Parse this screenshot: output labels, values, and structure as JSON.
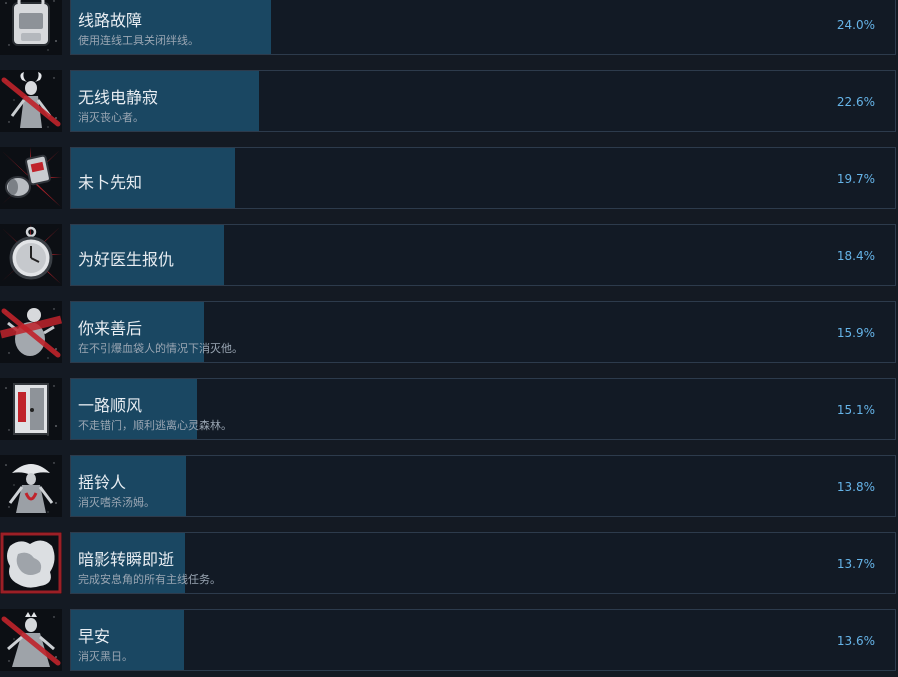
{
  "achievements": [
    {
      "title": "线路故障",
      "description": "使用连线工具关闭绊线。",
      "percent_text": "24.0%",
      "percent": 24.0,
      "icon": "backpack-icon"
    },
    {
      "title": "无线电静寂",
      "description": "消灭丧心者。",
      "percent_text": "22.6%",
      "percent": 22.6,
      "icon": "horned-creature-icon"
    },
    {
      "title": "未卜先知",
      "description": "",
      "percent_text": "19.7%",
      "percent": 19.7,
      "icon": "explosive-barrel-icon"
    },
    {
      "title": "为好医生报仇",
      "description": "",
      "percent_text": "18.4%",
      "percent": 18.4,
      "icon": "pocket-watch-icon"
    },
    {
      "title": "你来善后",
      "description": "在不引爆血袋人的情况下消灭他。",
      "percent_text": "15.9%",
      "percent": 15.9,
      "icon": "bloated-creature-icon"
    },
    {
      "title": "一路顺风",
      "description": "不走错门，顺利逃离心灵森林。",
      "percent_text": "15.1%",
      "percent": 15.1,
      "icon": "door-icon"
    },
    {
      "title": "摇铃人",
      "description": "消灭嗜杀汤姆。",
      "percent_text": "13.8%",
      "percent": 13.8,
      "icon": "hooded-figure-icon"
    },
    {
      "title": "暗影转瞬即逝",
      "description": "完成安息角的所有主线任务。",
      "percent_text": "13.7%",
      "percent": 13.7,
      "icon": "crumbled-map-icon"
    },
    {
      "title": "早安",
      "description": "消灭黑日。",
      "percent_text": "13.6%",
      "percent": 13.6,
      "icon": "crowned-creature-icon"
    }
  ],
  "colors": {
    "background": "#141a23",
    "panel": "#121a25",
    "panel_border": "#2d3b4c",
    "progress_fill": "#1a4762",
    "percent_text": "#66b4e8",
    "accent_red": "#c0232b"
  }
}
